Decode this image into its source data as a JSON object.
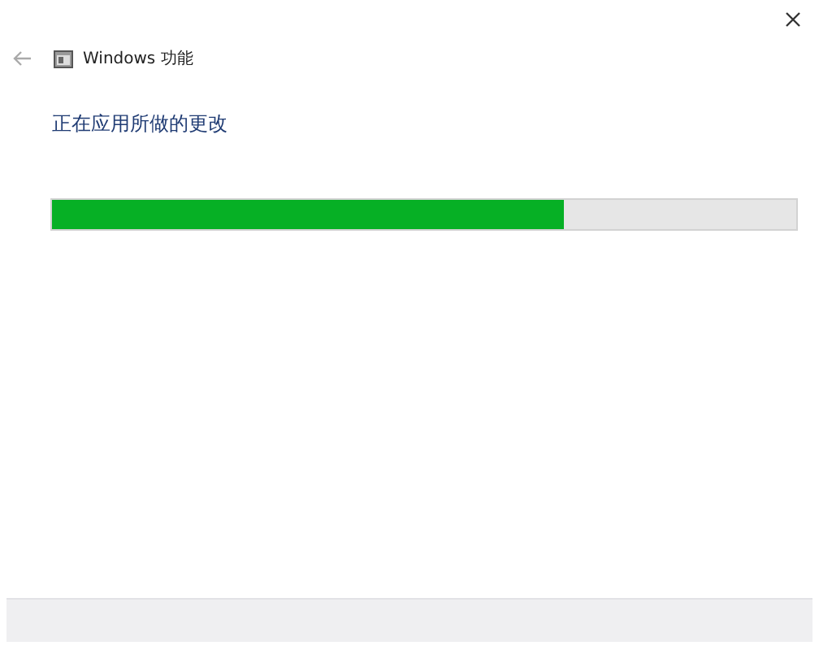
{
  "window": {
    "title": "Windows 功能"
  },
  "heading": "正在应用所做的更改",
  "progress": {
    "level": 0.687
  }
}
